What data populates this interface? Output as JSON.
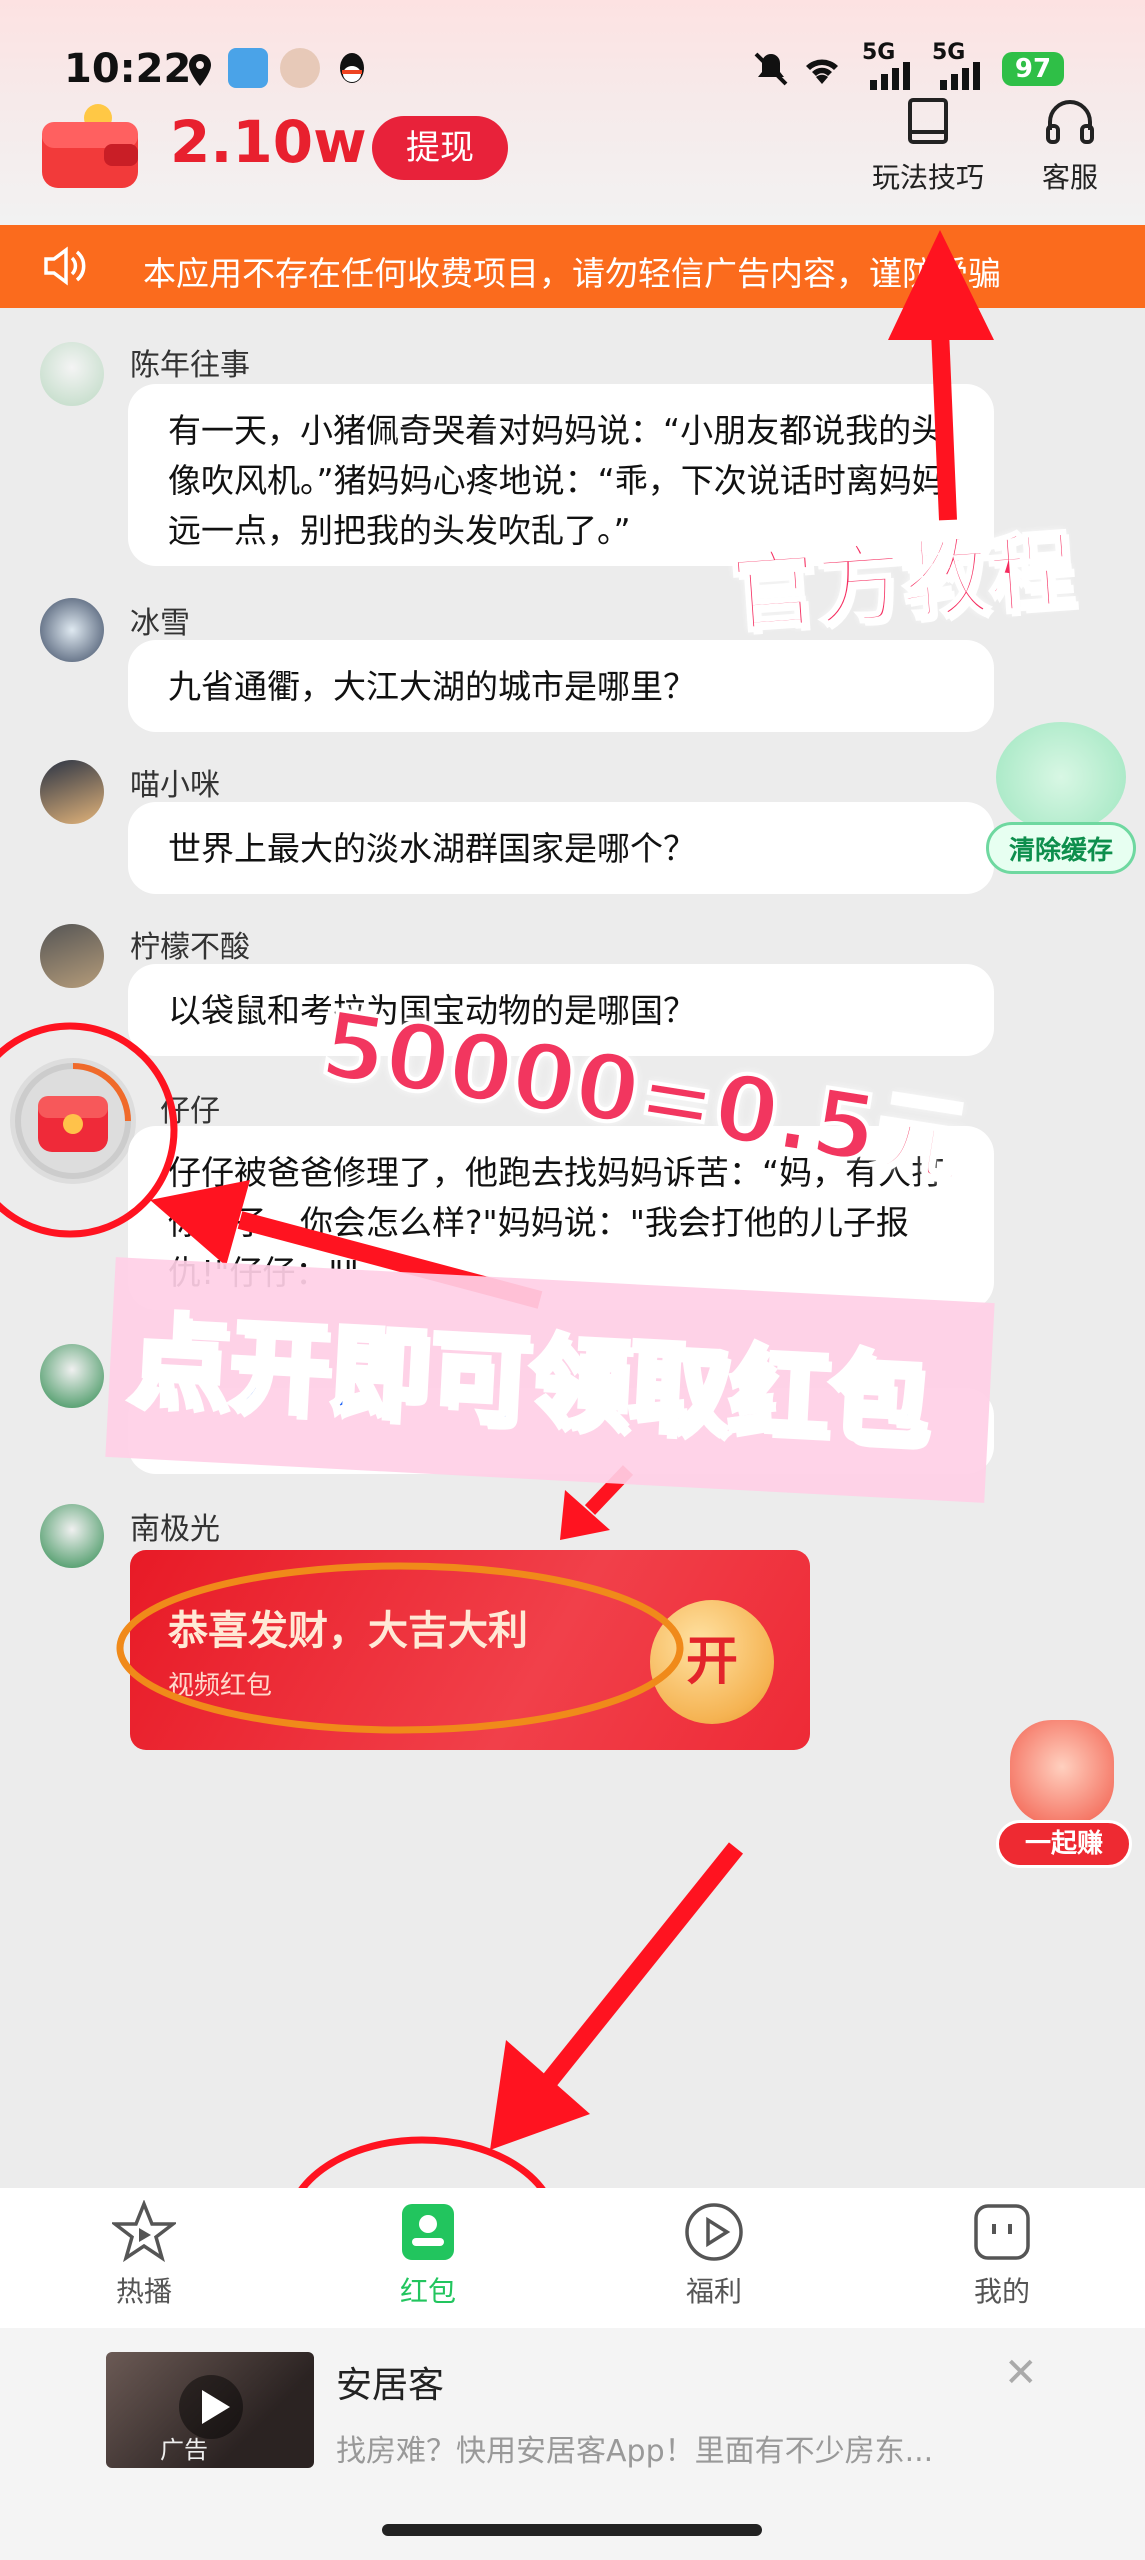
{
  "status_bar": {
    "time": "10:22",
    "network1": "5G",
    "network2": "5G",
    "battery": "97"
  },
  "header": {
    "balance": "2.10w",
    "withdraw_label": "提现",
    "tips_label": "玩法技巧",
    "service_label": "客服"
  },
  "notice": {
    "text": "本应用不存在任何收费项目，请勿轻信广告内容，谨防受骗"
  },
  "chat": {
    "messages": [
      {
        "user": "陈年往事",
        "text": "有一天，小猪佩奇哭着对妈妈说：“小朋友都说我的头像吹风机。”猪妈妈心疼地说：“乖，下次说话时离妈妈远一点，别把我的头发吹乱了。”"
      },
      {
        "user": "冰雪",
        "text": "九省通衢，大江大湖的城市是哪里？"
      },
      {
        "user": "喵小咪",
        "text": "世界上最大的淡水湖群国家是哪个？"
      },
      {
        "user": "柠檬不酸",
        "text": "以袋鼠和考拉为国宝动物的是哪国？"
      },
      {
        "user": "仔仔",
        "text": "仔仔被爸爸修理了，他跑去找妈妈诉苦：“妈，有人打你儿子，你会怎么样?\"妈妈说：\"我会打他的儿子报仇!\"仔仔：\"\""
      },
      {
        "user": "南极光",
        "text": ""
      }
    ],
    "red_packet": {
      "title": "恭喜发财，大吉大利",
      "subtitle": "视频红包",
      "open_label": "开"
    }
  },
  "widgets": {
    "clear_cache": "清除缓存",
    "earn_together": "一起赚"
  },
  "overlay": {
    "tutorial": "官方教程",
    "rate": "50000=0.5元",
    "claim": "点开即可领取红包"
  },
  "nav": {
    "items": [
      {
        "label": "热播"
      },
      {
        "label": "红包"
      },
      {
        "label": "福利"
      },
      {
        "label": "我的"
      }
    ]
  },
  "ad": {
    "title": "安居客",
    "description": "找房难？快用安居客App！里面有不少房东...",
    "tag": "广告"
  },
  "colors": {
    "accent": "#e8202e",
    "notice": "#fb6b1d",
    "nav_active": "#22c55e"
  }
}
